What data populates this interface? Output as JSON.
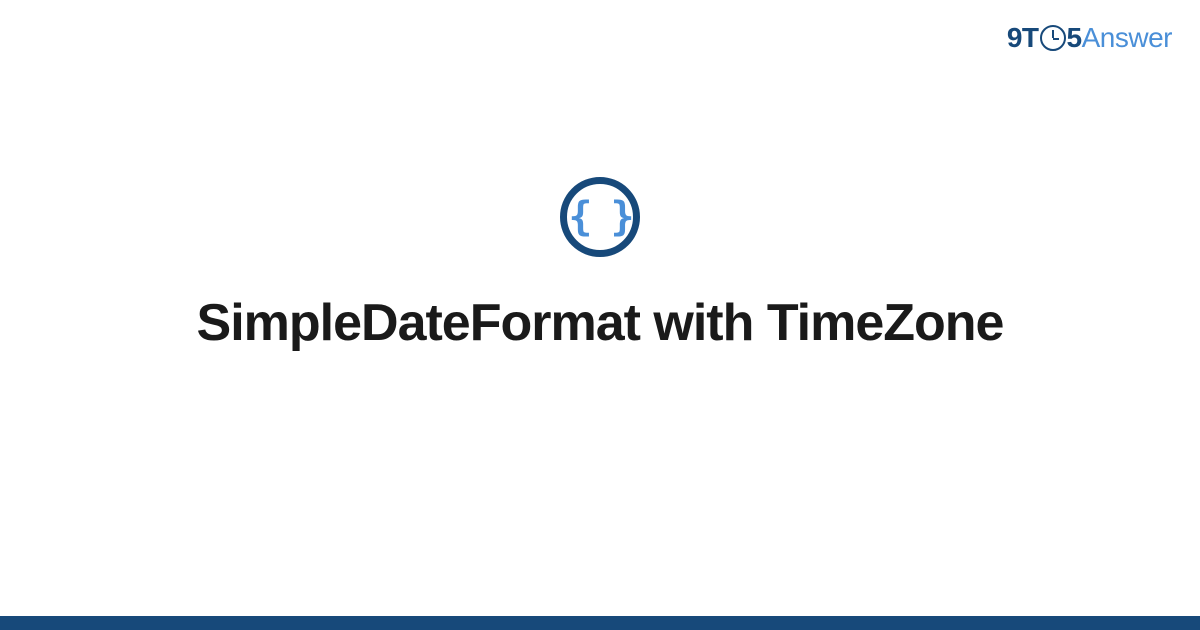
{
  "header": {
    "logo": {
      "prefix": "9T",
      "middle_icon": "clock-icon",
      "five": "5",
      "suffix": "Answer"
    }
  },
  "main": {
    "icon": "curly-braces-icon",
    "braces_text": "{ }",
    "title": "SimpleDateFormat with TimeZone"
  },
  "colors": {
    "brand_dark": "#17497a",
    "brand_light": "#4a8fd8",
    "text": "#1a1a1a"
  }
}
